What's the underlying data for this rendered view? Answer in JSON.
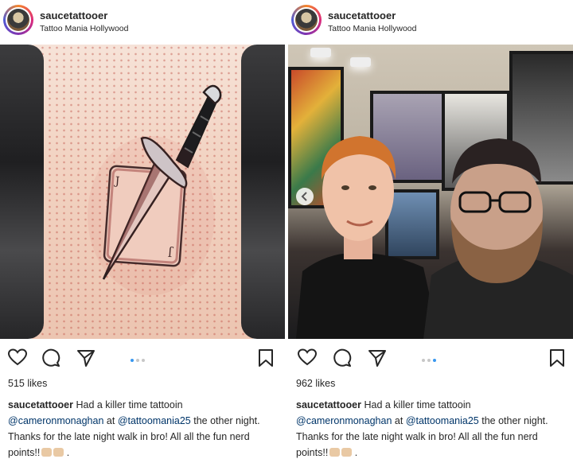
{
  "posts": [
    {
      "username": "saucetattooer",
      "location": "Tattoo Mania Hollywood",
      "likes": "515 likes",
      "caption_user": "saucetattooer",
      "caption_text_1": "Had a killer time tattooin",
      "mention_1": "@cameronmonaghan",
      "caption_text_2": "at",
      "mention_2": "@tattoomania25",
      "caption_text_3": "the other night. Thanks for the late night walk in bro! All all the fun nerd points!!",
      "caption_end": ".",
      "carousel_index": 1,
      "carousel_count": 3
    },
    {
      "username": "saucetattooer",
      "location": "Tattoo Mania Hollywood",
      "likes": "962 likes",
      "caption_user": "saucetattooer",
      "caption_text_1": "Had a killer time tattooin",
      "mention_1": "@cameronmonaghan",
      "caption_text_2": "at",
      "mention_2": "@tattoomania25",
      "caption_text_3": "the other night. Thanks for the late night walk in bro! All all the fun nerd points!!",
      "caption_end": ".",
      "carousel_index": 3,
      "carousel_count": 3
    }
  ],
  "icons": {
    "like": "heart-icon",
    "comment": "comment-icon",
    "share": "share-icon",
    "save": "bookmark-icon",
    "prev": "chevron-left-icon"
  },
  "colors": {
    "text": "#262626",
    "mention": "#003569",
    "carousel_active": "#3897f0",
    "carousel_inactive": "#c7c7c7"
  }
}
